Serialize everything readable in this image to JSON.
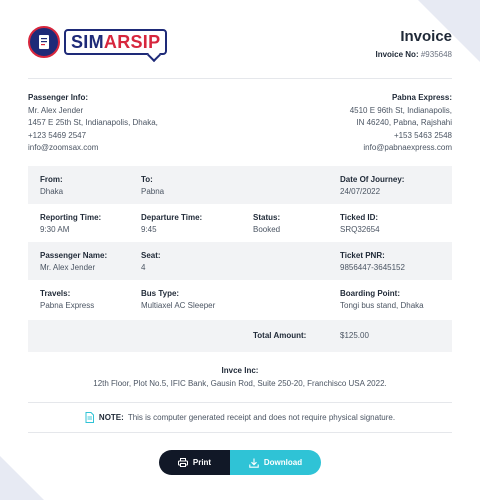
{
  "brand": {
    "logo_sim": "SIM",
    "logo_arsip": "ARSIP"
  },
  "invoice": {
    "title": "Invoice",
    "number_label": "Invoice No:",
    "number_value": "#935648"
  },
  "passenger": {
    "heading": "Passenger Info:",
    "name": "Mr. Alex Jender",
    "address": "1457 E 25th St, Indianapolis, Dhaka,",
    "phone": "+123 5469 2547",
    "email": "info@zoomsax.com"
  },
  "company_party": {
    "heading": "Pabna Express:",
    "address1": "4510 E 96th St, Indianapolis,",
    "address2": "IN 46240, Pabna, Rajshahi",
    "phone": "+153 5463 2548",
    "email": "info@pabnaexpress.com"
  },
  "details": {
    "from_label": "From:",
    "from_value": "Dhaka",
    "to_label": "To:",
    "to_value": "Pabna",
    "date_label": "Date Of Journey:",
    "date_value": "24/07/2022",
    "reporting_label": "Reporting Time:",
    "reporting_value": "9:30 AM",
    "departure_label": "Departure Time:",
    "departure_value": "9:45",
    "status_label": "Status:",
    "status_value": "Booked",
    "ticket_id_label": "Ticked ID:",
    "ticket_id_value": "SRQ32654",
    "passenger_label": "Passenger Name:",
    "passenger_value": "Mr. Alex Jender",
    "seat_label": "Seat:",
    "seat_value": "4",
    "pnr_label": "Ticket PNR:",
    "pnr_value": "9856447-3645152",
    "travels_label": "Travels:",
    "travels_value": "Pabna Express",
    "bus_type_label": "Bus Type:",
    "bus_type_value": "Multiaxel AC Sleeper",
    "boarding_label": "Boarding Point:",
    "boarding_value": "Tongi bus stand, Dhaka",
    "total_label": "Total Amount:",
    "total_value": "$125.00"
  },
  "footer": {
    "company_name": "Invce Inc:",
    "company_address": "12th Floor, Plot No.5, IFIC Bank, Gausin Rod, Suite 250-20, Franchisco USA 2022.",
    "note_label": "NOTE:",
    "note_text": "This is computer generated receipt and does not require physical signature."
  },
  "actions": {
    "print_label": "Print",
    "download_label": "Download"
  },
  "colors": {
    "brand_blue": "#1e2a78",
    "brand_red": "#d7263d",
    "accent": "#2fc3d6",
    "dark": "#111827",
    "row_shade": "#f2f3f5"
  },
  "icons": {
    "note": "document-icon",
    "print": "printer-icon",
    "download": "download-icon"
  }
}
